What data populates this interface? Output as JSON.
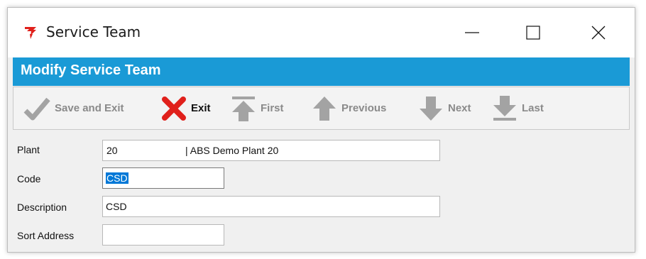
{
  "window": {
    "title": "Service Team",
    "icon": "red-app-logo-icon",
    "controls": {
      "minimize": "minimize-icon",
      "maximize": "maximize-icon",
      "close": "close-icon"
    }
  },
  "header": {
    "title": "Modify Service Team",
    "background": "#1a9ad6"
  },
  "toolbar": {
    "save_exit": "Save and Exit",
    "exit": "Exit",
    "first": "First",
    "previous": "Previous",
    "next": "Next",
    "last": "Last"
  },
  "form": {
    "plant": {
      "label": "Plant",
      "code": "20",
      "description": "| ABS Demo Plant 20"
    },
    "code": {
      "label": "Code",
      "value": "CSD"
    },
    "description": {
      "label": "Description",
      "value": "CSD"
    },
    "sort_address": {
      "label": "Sort Address",
      "value": ""
    }
  },
  "colors": {
    "accent": "#1a9ad6",
    "exit_red": "#e0201b",
    "disabled_gray": "#a0a0a0",
    "selection": "#0078d7"
  }
}
